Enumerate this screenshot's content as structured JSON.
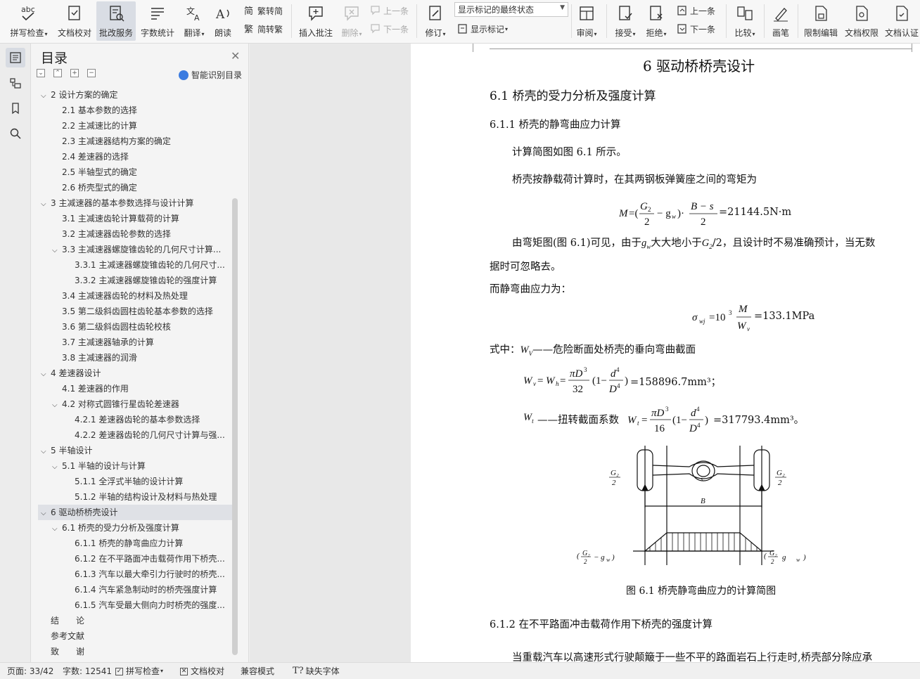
{
  "ribbon": {
    "spell_check": "拼写检查",
    "doc_proof": "文档校对",
    "review_service": "批改服务",
    "word_count": "字数统计",
    "translate": "翻译",
    "read_aloud": "朗读",
    "trad_to_simp": "繁转简",
    "simp_to_trad": "简转繁",
    "insert_comment": "插入批注",
    "delete": "删除",
    "prev_comment": "上一条",
    "next_comment": "下一条",
    "track_changes": "修订",
    "markup_select": "显示标记的最终状态",
    "show_markup": "显示标记",
    "review": "审阅",
    "accept": "接受",
    "reject": "拒绝",
    "prev_change": "上一条",
    "next_change": "下一条",
    "compare": "比较",
    "pen": "画笔",
    "restrict_edit": "限制编辑",
    "doc_permission": "文档权限",
    "doc_cert": "文档认证"
  },
  "toc": {
    "title": "目录",
    "smart_toc": "智能识别目录",
    "items": [
      {
        "label": "2  设计方案的确定",
        "level": 1,
        "chevron": "v"
      },
      {
        "label": "2.1  基本参数的选择",
        "level": 2,
        "chevron": ""
      },
      {
        "label": "2.2  主减速比的计算",
        "level": 2,
        "chevron": ""
      },
      {
        "label": "2.3  主减速器结构方案的确定",
        "level": 2,
        "chevron": ""
      },
      {
        "label": "2.4  差速器的选择",
        "level": 2,
        "chevron": ""
      },
      {
        "label": "2.5  半轴型式的确定",
        "level": 2,
        "chevron": ""
      },
      {
        "label": "2.6  桥壳型式的确定",
        "level": 2,
        "chevron": ""
      },
      {
        "label": "3  主减速器的基本参数选择与设计计算",
        "level": 1,
        "chevron": "v"
      },
      {
        "label": "3.1  主减速齿轮计算载荷的计算",
        "level": 2,
        "chevron": ""
      },
      {
        "label": "3.2  主减速器齿轮参数的选择",
        "level": 2,
        "chevron": ""
      },
      {
        "label": "3.3  主减速器螺旋锥齿轮的几何尺寸计算...",
        "level": 2,
        "chevron": "v"
      },
      {
        "label": "3.3.1  主减速器螺旋锥齿轮的几何尺寸...",
        "level": 3,
        "chevron": ""
      },
      {
        "label": "3.3.2  主减速器螺旋锥齿轮的强度计算",
        "level": 3,
        "chevron": ""
      },
      {
        "label": "3.4  主减速器齿轮的材料及热处理",
        "level": 2,
        "chevron": ""
      },
      {
        "label": "3.5  第二级斜齿圆柱齿轮基本参数的选择",
        "level": 2,
        "chevron": ""
      },
      {
        "label": "3.6  第二级斜齿圆柱齿轮校核",
        "level": 2,
        "chevron": ""
      },
      {
        "label": "3.7  主减速器轴承的计算",
        "level": 2,
        "chevron": ""
      },
      {
        "label": "3.8  主减速器的润滑",
        "level": 2,
        "chevron": ""
      },
      {
        "label": "4  差速器设计",
        "level": 1,
        "chevron": "v"
      },
      {
        "label": "4.1  差速器的作用",
        "level": 2,
        "chevron": ""
      },
      {
        "label": "4.2  对称式圆锥行星齿轮差速器",
        "level": 2,
        "chevron": "v"
      },
      {
        "label": "4.2.1  差速器齿轮的基本参数选择",
        "level": 3,
        "chevron": ""
      },
      {
        "label": "4.2.2  差速器齿轮的几何尺寸计算与强...",
        "level": 3,
        "chevron": ""
      },
      {
        "label": "5  半轴设计",
        "level": 1,
        "chevron": "v"
      },
      {
        "label": "5.1  半轴的设计与计算",
        "level": 2,
        "chevron": "v"
      },
      {
        "label": "5.1.1  全浮式半轴的设计计算",
        "level": 3,
        "chevron": ""
      },
      {
        "label": "5.1.2  半轴的结构设计及材料与热处理",
        "level": 3,
        "chevron": ""
      },
      {
        "label": "6  驱动桥桥壳设计",
        "level": 1,
        "chevron": "v",
        "selected": true
      },
      {
        "label": "6.1  桥壳的受力分析及强度计算",
        "level": 2,
        "chevron": "v"
      },
      {
        "label": "6.1.1  桥壳的静弯曲应力计算",
        "level": 3,
        "chevron": ""
      },
      {
        "label": "6.1.2  在不平路面冲击载荷作用下桥壳...",
        "level": 3,
        "chevron": ""
      },
      {
        "label": "6.1.3  汽车以最大牵引力行驶时的桥壳...",
        "level": 3,
        "chevron": ""
      },
      {
        "label": "6.1.4  汽车紧急制动时的桥壳强度计算",
        "level": 3,
        "chevron": ""
      },
      {
        "label": "6.1.5  汽车受最大侧向力时桥壳的强度...",
        "level": 3,
        "chevron": ""
      },
      {
        "label": "结　　论",
        "level": 1,
        "chevron": ""
      },
      {
        "label": "参考文献",
        "level": 1,
        "chevron": ""
      },
      {
        "label": "致　　谢",
        "level": 1,
        "chevron": ""
      }
    ]
  },
  "doc": {
    "chapter_title": "6  驱动桥桥壳设计",
    "section_title": "6.1  桥壳的受力分析及强度计算",
    "subsection_title": "6.1.1  桥壳的静弯曲应力计算",
    "p1": "计算简图如图 6.1 所示。",
    "p2": "桥壳按静载荷计算时，在其两钢板弹簧座之间的弯矩为",
    "eq1_result": "=21144.5N·m",
    "p3a": "由弯矩图(图 6.1)可见，由于",
    "p3b": "大大地小于",
    "p3c": "，且设计时不易准确预计，当无数",
    "p3d": "据时可忽略去。",
    "p4": "而静弯曲应力为：",
    "eq2_result": "=133.1MPa",
    "p5a": "式中：",
    "p5b": "——危险断面处桥壳的垂向弯曲截面",
    "eq3_result": "=158896.7mm³；",
    "p6": "——扭转截面系数",
    "eq4_result": "=317793.4mm³。",
    "figure_caption": "图 6.1   桥壳静弯曲应力的计算简图",
    "next_subsection": "6.1.2  在不平路面冲击载荷作用下桥壳的强度计算",
    "p7": "当重载汽车以高速形式行驶颠簸于一些不平的路面岩石上行走时,桥壳部分除应承"
  },
  "status": {
    "page": "页面: 33/42",
    "words": "字数: 12541",
    "spell": "拼写检查",
    "proof": "文档校对",
    "compat": "兼容模式",
    "missing_font": "缺失字体"
  }
}
